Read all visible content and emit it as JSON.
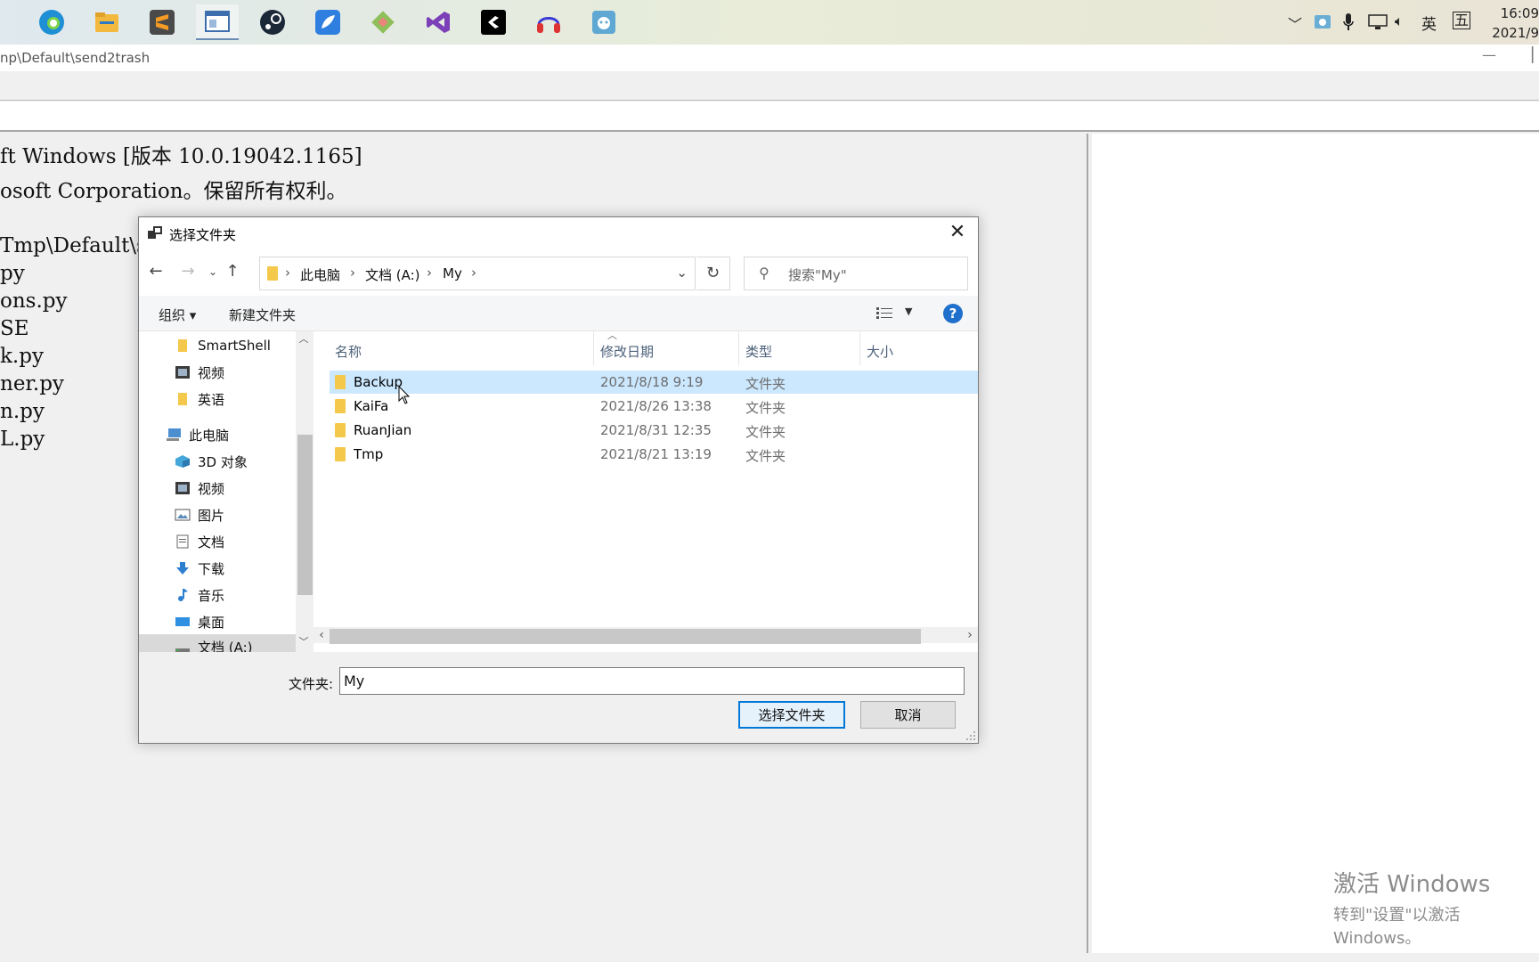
{
  "taskbar": {
    "apps": [
      {
        "icon": "partial-icon"
      },
      {
        "icon": "edge-icon",
        "color": "#1e8fd5"
      },
      {
        "icon": "file-explorer-icon",
        "color": "#f3b93e"
      },
      {
        "icon": "sublime-text-icon",
        "color": "#4a4a4a"
      },
      {
        "icon": "window-app-icon",
        "color": "#3d6fae"
      },
      {
        "icon": "steam-icon",
        "color": "#1b2838"
      },
      {
        "icon": "feather-app-icon",
        "color": "#2f7fe0"
      },
      {
        "icon": "git-icon",
        "color": "#8fbf5a"
      },
      {
        "icon": "visual-studio-icon",
        "color": "#7b3fb7"
      },
      {
        "icon": "unity-icon",
        "color": "#000000"
      },
      {
        "icon": "headphones-app-icon",
        "color": "#3a3ad6"
      },
      {
        "icon": "live-chat-icon",
        "color": "#5fa8d3"
      }
    ],
    "tray": {
      "ime_label": "英",
      "ime_mode": "五",
      "time": "16:09",
      "date": "2021/9"
    }
  },
  "background_window": {
    "title_path": "np\\Default\\send2trash",
    "console_lines": [
      "ft Windows [版本 10.0.19042.1165]",
      "osoft Corporation。保留所有权利。",
      "",
      "Tmp\\Default\\s",
      "py",
      "ons.py",
      "SE",
      "k.py",
      "ner.py",
      "n.py",
      "L.py"
    ],
    "watermark_title": "激活 Windows",
    "watermark_sub": "转到\"设置\"以激活 Windows。"
  },
  "dialog": {
    "title": "选择文件夹",
    "close_label": "✕",
    "breadcrumb": [
      "此电脑",
      "文档 (A:)",
      "My"
    ],
    "search_placeholder": "搜索\"My\"",
    "commands": {
      "organize": "组织 ▾",
      "new_folder": "新建文件夹",
      "help": "?"
    },
    "nav_items": [
      {
        "label": "SmartShell",
        "icon": "folder-icon"
      },
      {
        "label": "视频",
        "icon": "video-icon"
      },
      {
        "label": "英语",
        "icon": "folder-icon"
      },
      {
        "label": "此电脑",
        "icon": "computer-icon"
      },
      {
        "label": "3D 对象",
        "icon": "3d-objects-icon"
      },
      {
        "label": "视频",
        "icon": "video-icon"
      },
      {
        "label": "图片",
        "icon": "pictures-icon"
      },
      {
        "label": "文档",
        "icon": "documents-icon"
      },
      {
        "label": "下载",
        "icon": "download-icon"
      },
      {
        "label": "音乐",
        "icon": "music-icon"
      },
      {
        "label": "桌面",
        "icon": "desktop-icon"
      },
      {
        "label": "文档 (A:)",
        "icon": "drive-icon"
      }
    ],
    "columns": [
      "名称",
      "修改日期",
      "类型",
      "大小"
    ],
    "rows": [
      {
        "name": "Backup",
        "date": "2021/8/18 9:19",
        "type": "文件夹"
      },
      {
        "name": "KaiFa",
        "date": "2021/8/26 13:38",
        "type": "文件夹"
      },
      {
        "name": "RuanJian",
        "date": "2021/8/31 12:35",
        "type": "文件夹"
      },
      {
        "name": "Tmp",
        "date": "2021/8/21 13:19",
        "type": "文件夹"
      }
    ],
    "folder_label": "文件夹:",
    "folder_value": "My",
    "select_button": "选择文件夹",
    "cancel_button": "取消"
  }
}
